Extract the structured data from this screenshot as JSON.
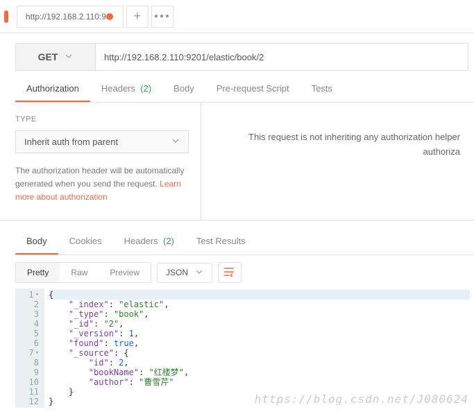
{
  "tabs": {
    "items": [
      {
        "label": "http://192.168.2.110:9",
        "dirty": true
      }
    ]
  },
  "request": {
    "method": "GET",
    "url": "http://192.168.2.110:9201/elastic/book/2"
  },
  "req_tabs": {
    "authorization": "Authorization",
    "headers": "Headers",
    "headers_count": "(2)",
    "body": "Body",
    "pre": "Pre-request Script",
    "tests": "Tests"
  },
  "auth": {
    "type_label": "TYPE",
    "selected": "Inherit auth from parent",
    "desc_pre": "The authorization header will be automatically generated when you send the request. ",
    "desc_link": "Learn more about authorization",
    "right_msg": "This request is not inheriting any authorization helper",
    "right_msg2": "authoriza"
  },
  "resp_tabs": {
    "body": "Body",
    "cookies": "Cookies",
    "headers": "Headers",
    "headers_count": "(2)",
    "tests": "Test Results"
  },
  "body_view": {
    "pretty": "Pretty",
    "raw": "Raw",
    "preview": "Preview",
    "format": "JSON"
  },
  "json_lines": [
    {
      "n": 1,
      "fold": true,
      "tokens": [
        {
          "t": "punct",
          "v": "{"
        }
      ]
    },
    {
      "n": 2,
      "tokens": [
        {
          "t": "key",
          "v": "\"_index\""
        },
        {
          "t": "punct",
          "v": ": "
        },
        {
          "t": "str",
          "v": "\"elastic\""
        },
        {
          "t": "punct",
          "v": ","
        }
      ],
      "indent": 4
    },
    {
      "n": 3,
      "tokens": [
        {
          "t": "key",
          "v": "\"_type\""
        },
        {
          "t": "punct",
          "v": ": "
        },
        {
          "t": "str",
          "v": "\"book\""
        },
        {
          "t": "punct",
          "v": ","
        }
      ],
      "indent": 4
    },
    {
      "n": 4,
      "tokens": [
        {
          "t": "key",
          "v": "\"_id\""
        },
        {
          "t": "punct",
          "v": ": "
        },
        {
          "t": "str",
          "v": "\"2\""
        },
        {
          "t": "punct",
          "v": ","
        }
      ],
      "indent": 4
    },
    {
      "n": 5,
      "tokens": [
        {
          "t": "key",
          "v": "\"_version\""
        },
        {
          "t": "punct",
          "v": ": "
        },
        {
          "t": "num",
          "v": "1"
        },
        {
          "t": "punct",
          "v": ","
        }
      ],
      "indent": 4
    },
    {
      "n": 6,
      "tokens": [
        {
          "t": "key",
          "v": "\"found\""
        },
        {
          "t": "punct",
          "v": ": "
        },
        {
          "t": "bool",
          "v": "true"
        },
        {
          "t": "punct",
          "v": ","
        }
      ],
      "indent": 4
    },
    {
      "n": 7,
      "fold": true,
      "tokens": [
        {
          "t": "key",
          "v": "\"_source\""
        },
        {
          "t": "punct",
          "v": ": {"
        }
      ],
      "indent": 4
    },
    {
      "n": 8,
      "tokens": [
        {
          "t": "key",
          "v": "\"id\""
        },
        {
          "t": "punct",
          "v": ": "
        },
        {
          "t": "num",
          "v": "2"
        },
        {
          "t": "punct",
          "v": ","
        }
      ],
      "indent": 8
    },
    {
      "n": 9,
      "tokens": [
        {
          "t": "key",
          "v": "\"bookName\""
        },
        {
          "t": "punct",
          "v": ": "
        },
        {
          "t": "str",
          "v": "\"红楼梦\""
        },
        {
          "t": "punct",
          "v": ","
        }
      ],
      "indent": 8
    },
    {
      "n": 10,
      "tokens": [
        {
          "t": "key",
          "v": "\"author\""
        },
        {
          "t": "punct",
          "v": ": "
        },
        {
          "t": "str",
          "v": "\"曹雪芹\""
        }
      ],
      "indent": 8
    },
    {
      "n": 11,
      "tokens": [
        {
          "t": "punct",
          "v": "}"
        }
      ],
      "indent": 4
    },
    {
      "n": 12,
      "tokens": [
        {
          "t": "punct",
          "v": "}"
        }
      ]
    }
  ],
  "watermark": "https://blog.csdn.net/J080624"
}
